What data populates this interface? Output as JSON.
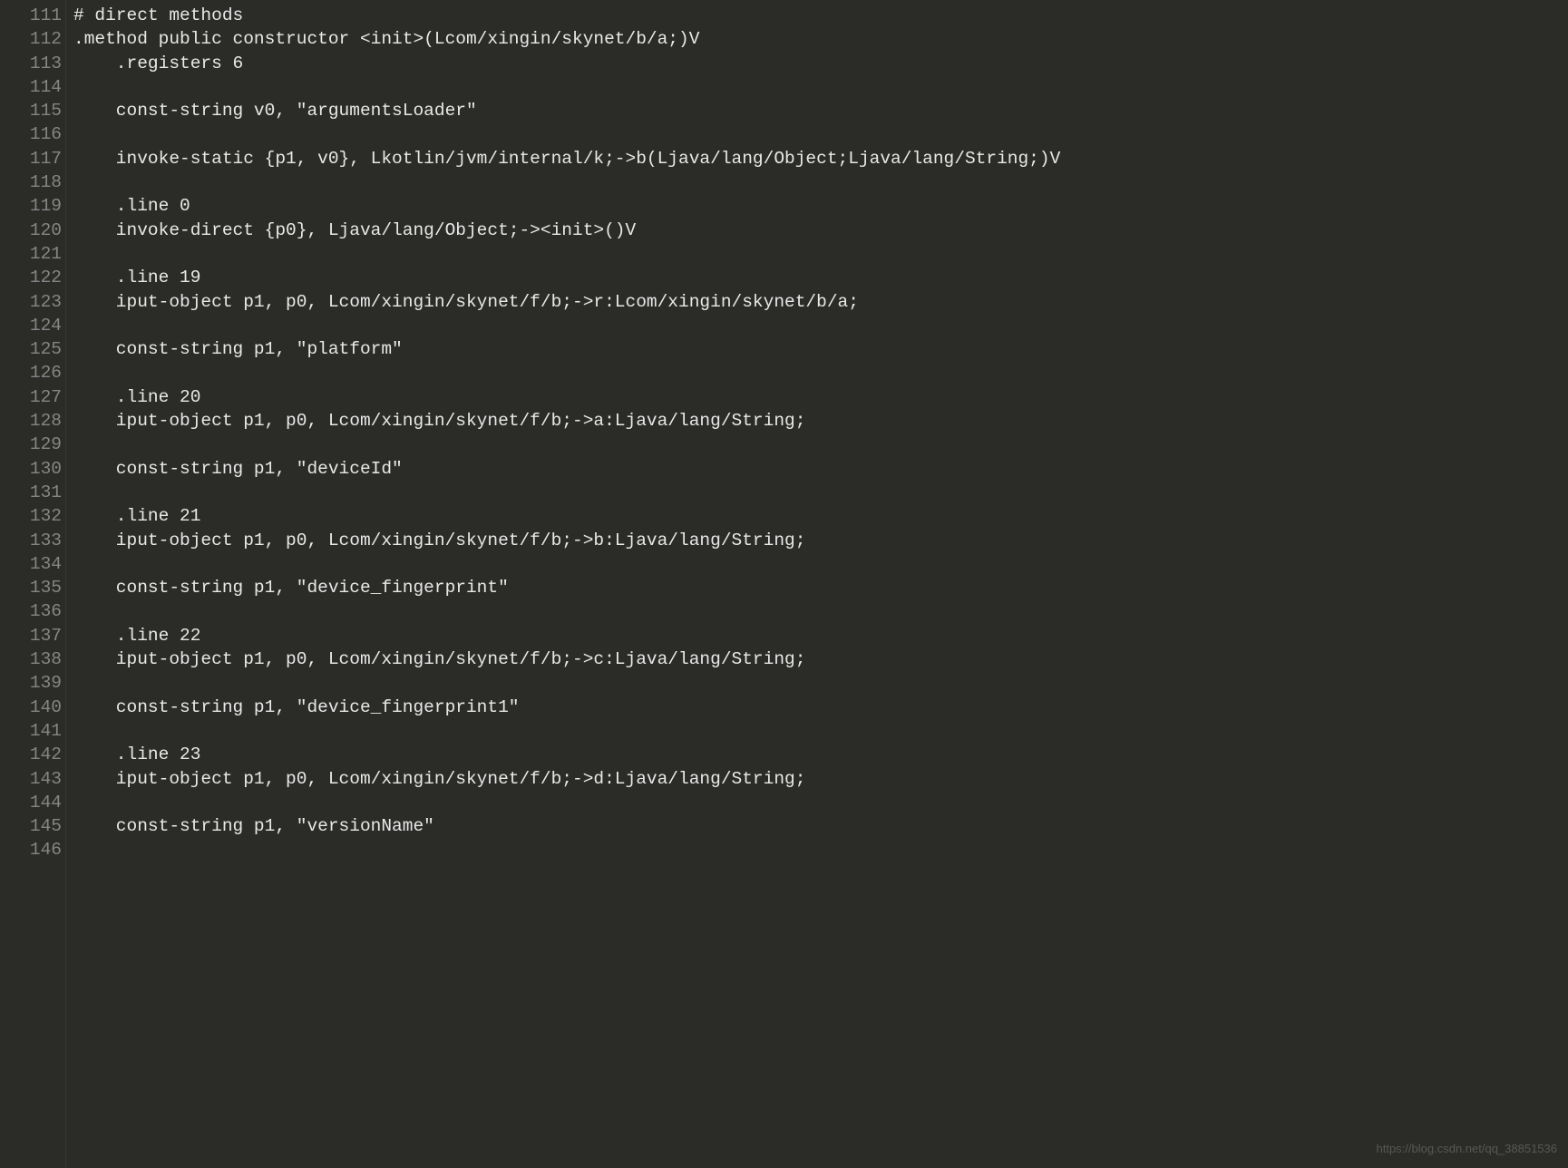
{
  "editor": {
    "startLine": 111,
    "lines": [
      {
        "indent": 0,
        "text": "# direct methods"
      },
      {
        "indent": 0,
        "text": ".method public constructor <init>(Lcom/xingin/skynet/b/a;)V"
      },
      {
        "indent": 1,
        "text": ".registers 6"
      },
      {
        "indent": 0,
        "text": ""
      },
      {
        "indent": 1,
        "text": "const-string v0, \"argumentsLoader\""
      },
      {
        "indent": 0,
        "text": ""
      },
      {
        "indent": 1,
        "text": "invoke-static {p1, v0}, Lkotlin/jvm/internal/k;->b(Ljava/lang/Object;Ljava/lang/String;)V"
      },
      {
        "indent": 0,
        "text": ""
      },
      {
        "indent": 1,
        "text": ".line 0"
      },
      {
        "indent": 1,
        "text": "invoke-direct {p0}, Ljava/lang/Object;-><init>()V"
      },
      {
        "indent": 0,
        "text": ""
      },
      {
        "indent": 1,
        "text": ".line 19"
      },
      {
        "indent": 1,
        "text": "iput-object p1, p0, Lcom/xingin/skynet/f/b;->r:Lcom/xingin/skynet/b/a;"
      },
      {
        "indent": 0,
        "text": ""
      },
      {
        "indent": 1,
        "text": "const-string p1, \"platform\""
      },
      {
        "indent": 0,
        "text": ""
      },
      {
        "indent": 1,
        "text": ".line 20"
      },
      {
        "indent": 1,
        "text": "iput-object p1, p0, Lcom/xingin/skynet/f/b;->a:Ljava/lang/String;"
      },
      {
        "indent": 0,
        "text": ""
      },
      {
        "indent": 1,
        "text": "const-string p1, \"deviceId\""
      },
      {
        "indent": 0,
        "text": ""
      },
      {
        "indent": 1,
        "text": ".line 21"
      },
      {
        "indent": 1,
        "text": "iput-object p1, p0, Lcom/xingin/skynet/f/b;->b:Ljava/lang/String;"
      },
      {
        "indent": 0,
        "text": ""
      },
      {
        "indent": 1,
        "text": "const-string p1, \"device_fingerprint\""
      },
      {
        "indent": 0,
        "text": ""
      },
      {
        "indent": 1,
        "text": ".line 22"
      },
      {
        "indent": 1,
        "text": "iput-object p1, p0, Lcom/xingin/skynet/f/b;->c:Ljava/lang/String;"
      },
      {
        "indent": 0,
        "text": ""
      },
      {
        "indent": 1,
        "text": "const-string p1, \"device_fingerprint1\""
      },
      {
        "indent": 0,
        "text": ""
      },
      {
        "indent": 1,
        "text": ".line 23"
      },
      {
        "indent": 1,
        "text": "iput-object p1, p0, Lcom/xingin/skynet/f/b;->d:Ljava/lang/String;"
      },
      {
        "indent": 0,
        "text": ""
      },
      {
        "indent": 1,
        "text": "const-string p1, \"versionName\""
      },
      {
        "indent": 0,
        "text": ""
      }
    ]
  },
  "watermark": "https://blog.csdn.net/qq_38851536"
}
